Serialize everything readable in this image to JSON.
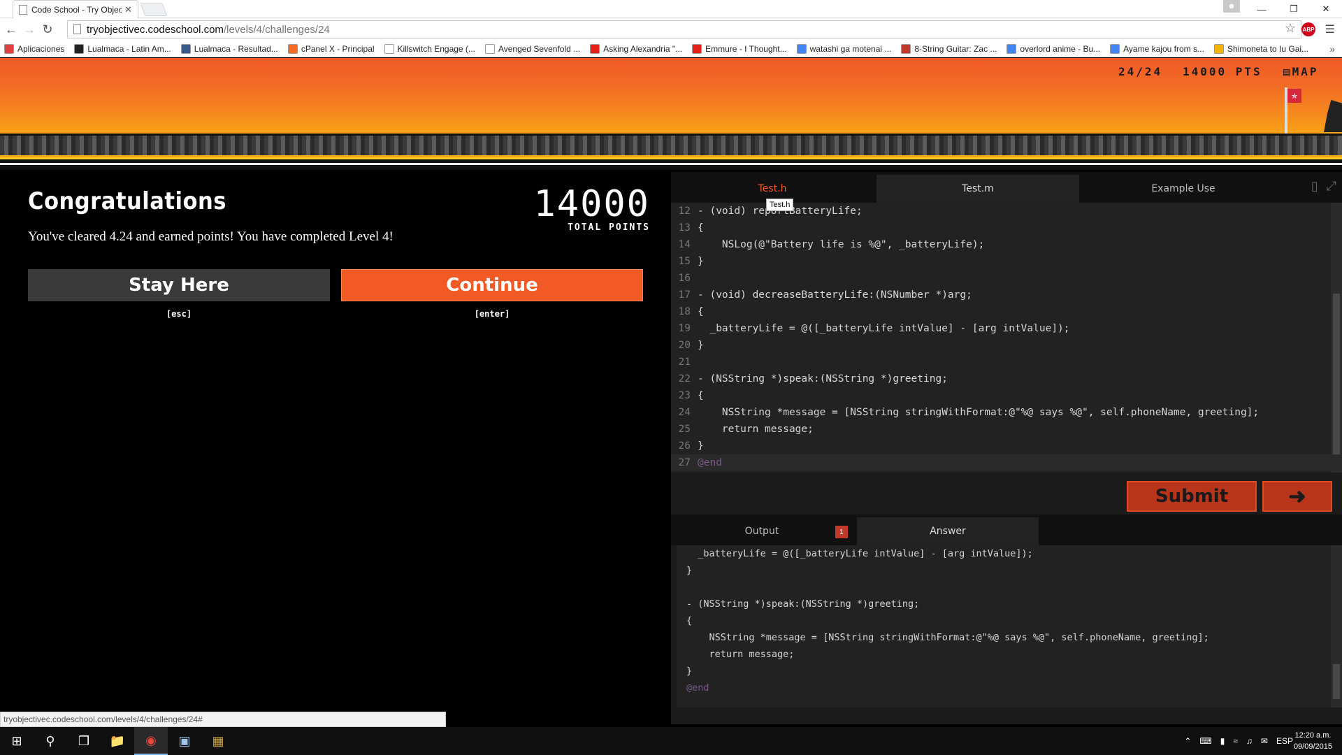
{
  "browser": {
    "tab_title": "Code School - Try Objecti",
    "tab_close": "✕",
    "url_host": "tryobjectivec.codeschool.com",
    "url_path": "/levels/4/challenges/24",
    "abp_label": "ABP",
    "status_url": "tryobjectivec.codeschool.com/levels/4/challenges/24#"
  },
  "bookmarks": [
    {
      "label": "Aplicaciones",
      "color": "#e04040"
    },
    {
      "label": "Lualmaca - Latin Am...",
      "color": "#222222"
    },
    {
      "label": "Lualmaca - Resultad...",
      "color": "#3a5a8a"
    },
    {
      "label": "cPanel X - Principal",
      "color": "#f36b25"
    },
    {
      "label": "Killswitch Engage (...",
      "color": "#ffffff"
    },
    {
      "label": "Avenged Sevenfold ...",
      "color": "#ffffff"
    },
    {
      "label": "Asking Alexandria \"...",
      "color": "#e62117"
    },
    {
      "label": "Emmure - I Thought...",
      "color": "#e62117"
    },
    {
      "label": "watashi ga motenai ...",
      "color": "#4285f4"
    },
    {
      "label": "8-String Guitar: Zac ...",
      "color": "#c0392b"
    },
    {
      "label": "overlord anime - Bu...",
      "color": "#4285f4"
    },
    {
      "label": "Ayame kajou from s...",
      "color": "#4285f4"
    },
    {
      "label": "Shimoneta to Iu Gai...",
      "color": "#f5b400"
    }
  ],
  "hud": {
    "progress": "24/24",
    "points": "14000 PTS",
    "map": "MAP"
  },
  "congrats": {
    "title": "Congratulations",
    "message": "You've cleared 4.24 and earned points! You have completed Level 4!",
    "points_value": "14000",
    "points_label": "TOTAL POINTS",
    "stay_label": "Stay Here",
    "stay_key": "[esc]",
    "continue_label": "Continue",
    "continue_key": "[enter]"
  },
  "editor": {
    "tabs": [
      "Test.h",
      "Test.m",
      "Example Use"
    ],
    "tooltip": "Test.h",
    "submit_label": "Submit",
    "next_label": "➜",
    "output_tabs": [
      "Output",
      "Answer"
    ],
    "output_badge": "1"
  },
  "code_lines": [
    {
      "n": "12",
      "t": "- (void) reportBatteryLife;"
    },
    {
      "n": "13",
      "t": "{"
    },
    {
      "n": "14",
      "t": "    NSLog(@\"Battery life is %@\", _batteryLife);"
    },
    {
      "n": "15",
      "t": "}"
    },
    {
      "n": "16",
      "t": ""
    },
    {
      "n": "17",
      "t": "- (void) decreaseBatteryLife:(NSNumber *)arg;"
    },
    {
      "n": "18",
      "t": "{"
    },
    {
      "n": "19",
      "t": "  _batteryLife = @([_batteryLife intValue] - [arg intValue]);"
    },
    {
      "n": "20",
      "t": "}"
    },
    {
      "n": "21",
      "t": ""
    },
    {
      "n": "22",
      "t": "- (NSString *)speak:(NSString *)greeting;"
    },
    {
      "n": "23",
      "t": "{"
    },
    {
      "n": "24",
      "t": "    NSString *message = [NSString stringWithFormat:@\"%@ says %@\", self.phoneName, greeting];"
    },
    {
      "n": "25",
      "t": "    return message;"
    },
    {
      "n": "26",
      "t": "}"
    },
    {
      "n": "27",
      "t": "@end"
    }
  ],
  "answer_lines": [
    "  _batteryLife = @([_batteryLife intValue] - [arg intValue]);",
    "}",
    "",
    "- (NSString *)speak:(NSString *)greeting;",
    "{",
    "    NSString *message = [NSString stringWithFormat:@\"%@ says %@\", self.phoneName, greeting];",
    "    return message;",
    "}",
    "@end"
  ],
  "taskbar": {
    "lang": "ESP",
    "time": "12:20 a.m.",
    "date": "09/09/2015"
  }
}
